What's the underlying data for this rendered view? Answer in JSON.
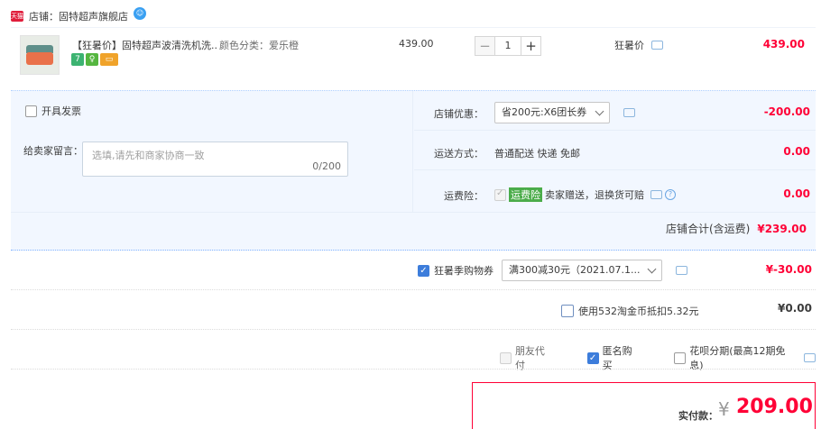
{
  "shop": {
    "label": "店铺：",
    "name": "固特超声旗舰店",
    "logo_text": "天猫"
  },
  "item": {
    "title": "【狂暑价】固特超声波清洗机洗...",
    "sku": "颜色分类：爱乐橙",
    "badges": [
      "7",
      "♀",
      "▭"
    ],
    "price": "439.00",
    "quantity": "1",
    "qty_minus": "−",
    "qty_plus": "+",
    "promo": "狂暑价",
    "total": "439.00"
  },
  "options": {
    "invoice_label": "开具发票",
    "message_label": "给卖家留言：",
    "message_placeholder": "选填,请先和商家协商一致",
    "message_count": "0/200",
    "shop_discount_label": "店铺优惠：",
    "shop_discount_value": "省200元:X6团长券",
    "shop_discount_amount": "-200.00",
    "shipping_label": "运送方式：",
    "shipping_value": "普通配送 快递 免邮",
    "shipping_amount": "0.00",
    "insurance_label": "运费险：",
    "insurance_tag": "运费险",
    "insurance_desc": "卖家赠送，退换货可赔",
    "insurance_amount": "0.00",
    "subtotal_label": "店铺合计(含运费)",
    "subtotal_amount": "¥239.00"
  },
  "coupon": {
    "label": "狂暑季购物券",
    "value": "满300减30元（2021.07.1...",
    "amount": "¥-30.00"
  },
  "taojinbi": {
    "label": "使用532淘金币抵扣5.32元",
    "amount": "¥0.00"
  },
  "extras": {
    "friend_pay": "朋友代付",
    "anonymous": "匿名购买",
    "huabei": "花呗分期(最高12期免息)"
  },
  "pay": {
    "label": "实付款：",
    "currency": "¥",
    "amount": "209.00"
  },
  "colors": {
    "accent_red": "#ff0036",
    "panel_blue": "#f2f7ff",
    "check_blue": "#3d7ddb",
    "tmall_red": "#e01e3c"
  }
}
